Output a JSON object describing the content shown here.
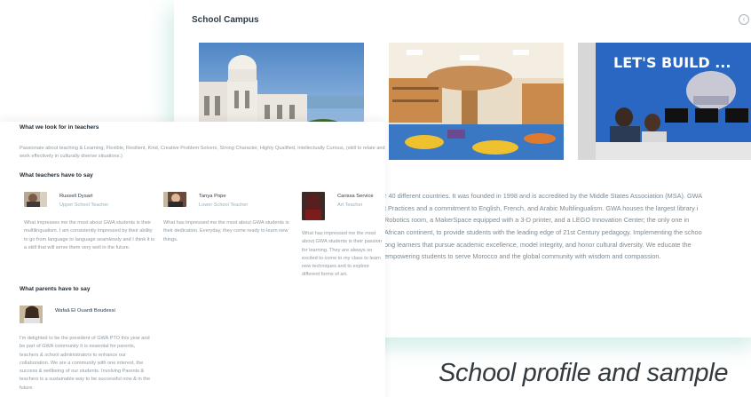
{
  "campus": {
    "title": "School Campus",
    "prev_icon": "‹",
    "photos": [
      {
        "name": "campus-building-photo"
      },
      {
        "name": "library-tree-photo"
      },
      {
        "name": "makerspace-photo"
      }
    ],
    "text_lines": [
      "r 40 different countries. It was founded in 1998 and is accredited by the Middle States Association (MSA). GWA",
      "t Practices and a commitment to English, French, and Arabic Multilingualism. GWA houses the largest library i",
      "Robotics room, a MakerSpace equipped with a 3-D printer, and a LEGO Innovation Center; the only one in",
      "African continent, to provide students with the leading edge of 21st Century pedagogy. Implementing the schoo",
      "ong learners that pursue academic excellence, model integrity, and honor cultural diversity. We educate the",
      "empowering students to serve Morocco and the global community with wisdom and compassion."
    ]
  },
  "look_for": {
    "heading": "What we look for in teachers",
    "body": "Passionate about teaching & Learning, Flexible, Resilient, Kind, Creative Problem Solvers, Strong Character, Highly Qualified, Intellectually Curious, (skill to relate and work effectively in culturally diverse situations.)"
  },
  "teachers": {
    "heading": "What teachers have to say",
    "items": [
      {
        "name": "Russell Dysart",
        "role": "Upper School Teacher",
        "quote": "What impresses me the most about GWA students is their multilingualism. I am consistently impressed by their ability to go from language to language seamlessly and I think it is a skill that will serve them very well in the future."
      },
      {
        "name": "Tanya Pope",
        "role": "Lower School Teacher",
        "quote": "What has impressed me the most about GWA students is their dedication. Everyday, they come ready to learn new things."
      },
      {
        "name": "Carissa Service",
        "role": "Art Teacher",
        "quote": "What has impressed me the most about GWA students is their passion for learning. They are always so excited to come to my class to learn new techniques and to explore different forms of art."
      }
    ]
  },
  "parents": {
    "heading": "What parents have to say",
    "name": "Wafaâ El Ouardi Boudessi",
    "quote": "I'm delighted to be the president of GWA PTO this year and be part of GWA community It is essential for parents, teachers & school administrators to enhance our collaboration. We are a community with one interest, the success & wellbeing of our students. Involving Parents & teachers is a sustainable way to be successful now & in the future."
  },
  "caption": "School profile and sample"
}
